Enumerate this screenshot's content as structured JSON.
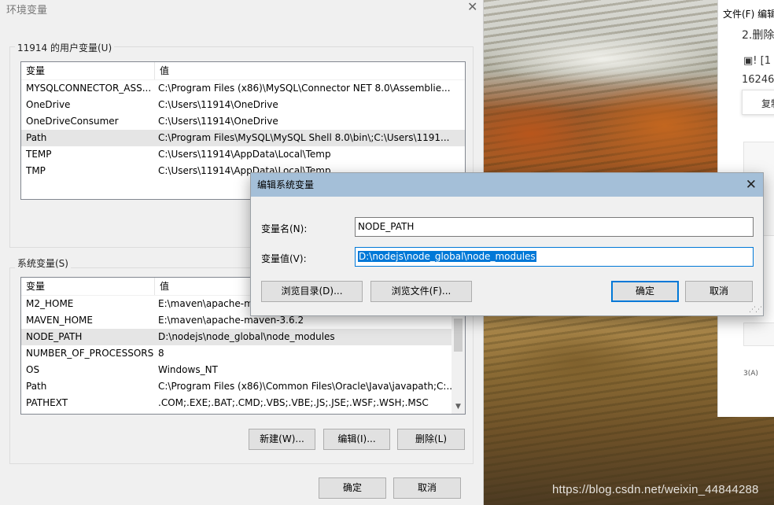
{
  "main_dialog": {
    "title": "环境变量",
    "close_glyph": "✕",
    "user_group_label": "11914 的用户变量(U)",
    "system_group_label": "系统变量(S)",
    "columns": {
      "name": "变量",
      "value": "值"
    },
    "user_vars": [
      {
        "name": "MYSQLCONNECTOR_ASS...",
        "value": "C:\\Program Files (x86)\\MySQL\\Connector NET 8.0\\Assemblie..."
      },
      {
        "name": "OneDrive",
        "value": "C:\\Users\\11914\\OneDrive"
      },
      {
        "name": "OneDriveConsumer",
        "value": "C:\\Users\\11914\\OneDrive"
      },
      {
        "name": "Path",
        "value": "C:\\Program Files\\MySQL\\MySQL Shell 8.0\\bin\\;C:\\Users\\1191..."
      },
      {
        "name": "TEMP",
        "value": "C:\\Users\\11914\\AppData\\Local\\Temp"
      },
      {
        "name": "TMP",
        "value": "C:\\Users\\11914\\AppData\\Local\\Temp"
      }
    ],
    "system_vars": [
      {
        "name": "M2_HOME",
        "value": "E:\\maven\\apache-m"
      },
      {
        "name": "MAVEN_HOME",
        "value": "E:\\maven\\apache-maven-3.6.2"
      },
      {
        "name": "NODE_PATH",
        "value": "D:\\nodejs\\node_global\\node_modules"
      },
      {
        "name": "NUMBER_OF_PROCESSORS",
        "value": "8"
      },
      {
        "name": "OS",
        "value": "Windows_NT"
      },
      {
        "name": "Path",
        "value": "C:\\Program Files (x86)\\Common Files\\Oracle\\Java\\javapath;C:..."
      },
      {
        "name": "PATHEXT",
        "value": ".COM;.EXE;.BAT;.CMD;.VBS;.VBE;.JS;.JSE;.WSF;.WSH;.MSC"
      }
    ],
    "buttons": {
      "new": "新建(W)...",
      "edit": "编辑(I)...",
      "delete": "删除(L)",
      "ok": "确定",
      "cancel": "取消"
    }
  },
  "edit_dialog": {
    "title": "编辑系统变量",
    "close_glyph": "✕",
    "name_label": "变量名(N):",
    "name_value": "NODE_PATH",
    "value_label": "变量值(V):",
    "value_value": "D:\\nodejs\\node_global\\node_modules",
    "buttons": {
      "browse_dir": "浏览目录(D)...",
      "browse_file": "浏览文件(F)...",
      "ok": "确定",
      "cancel": "取消"
    }
  },
  "editor_window": {
    "menu": "文件(F)   编辑",
    "line1": "2.删除",
    "line2": "! [1",
    "line3": "16246",
    "copy_button": "复制",
    "fragment": "3(A)"
  },
  "watermark": "https://blog.csdn.net/weixin_44844288",
  "colors": {
    "selection": "#0078d7",
    "title_bar": "#a4bfd8",
    "dialog_bg": "#f0f0f0"
  }
}
